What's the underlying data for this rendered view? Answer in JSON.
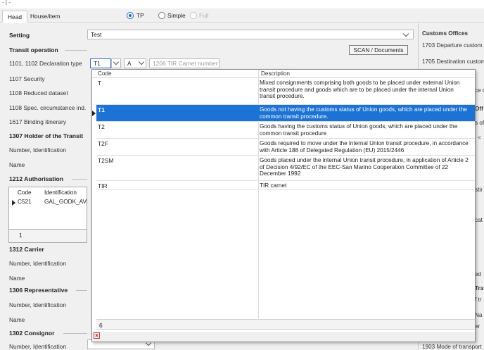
{
  "top_strip": "- | -",
  "tabs": [
    {
      "label": "Head",
      "active": true
    },
    {
      "label": "House/item",
      "active": false
    }
  ],
  "procedure_options": [
    {
      "label": "TP",
      "selected": true,
      "enabled": true
    },
    {
      "label": "Simple",
      "selected": false,
      "enabled": true
    },
    {
      "label": "Full",
      "selected": false,
      "enabled": false
    }
  ],
  "left": {
    "setting_label": "Setting",
    "transit_operation": "Transit operation",
    "declaration_type_label": "1101, 1102 Declaration type",
    "security_label": "1107 Security",
    "reduced_dataset_label": "1108 Reduced dataset",
    "spec_circumstance_label": "1108 Spec. circumstance ind.",
    "binding_itinerary_label": "1617 Binding itinerary",
    "holder_section": "1307 Holder of the Transit",
    "number_identification": "Number, Identification",
    "name_label": "Name",
    "authorisation_section": "1212 Authorisation",
    "auth_columns": [
      "Code",
      "Identification"
    ],
    "auth_rows": [
      {
        "code": "C521",
        "identification": "GAL_GODK_AVS"
      }
    ],
    "auth_count": "1",
    "carrier_section": "1312 Carrier",
    "carrier_number": "Number, Identification",
    "carrier_name": "Name",
    "representative_section": "1306 Representative",
    "representative_number": "Number, Identification",
    "representative_name": "Name",
    "consignor_section": "1302 Consignor",
    "consignor_number": "Number, Identification"
  },
  "middle": {
    "setting_value": "Test",
    "scan_button": "SCAN / Documents",
    "declaration_type_value": "T1",
    "second_select_value": "A",
    "tir_placeholder": "1206 TIR Carnet number"
  },
  "right": {
    "customs_offices": "Customs Offices",
    "departure": "1703 Departure custom",
    "destination": "1705 Destination custom",
    "frag_ce": "ce c",
    "frag_off": "Off",
    "frag_sof": "s of",
    "frag_lt": "<",
    "frag_stir": "stir",
    "frag_cat": "cat",
    "frag_ed": "ed",
    "frag_tra": "Tra",
    "frag_ftr": "f tr",
    "frag_na": "Na",
    "frag_er": "er",
    "frag_bottom": "1903 Mode of transport"
  },
  "dropdown": {
    "columns": [
      "Code",
      "Description"
    ],
    "rows": [
      {
        "code": "T",
        "description": "Mixed consignments comprising both goods to be placed under external Union transit procedure and goods which are to be placed under the internal Union transit procedure.",
        "selected": false
      },
      {
        "code": "T1",
        "description": "Goods not having the customs status of Union goods, which are placed under the common transit procedure.",
        "selected": true
      },
      {
        "code": "T2",
        "description": "Goods having the customs status of Union goods, which are placed under the common transit procedure",
        "selected": false
      },
      {
        "code": "T2F",
        "description": "Goods required to move under the internal Union transit procedure, in accordance with Article 188 of Delegated Regulation (EU) 2015/2446",
        "selected": false
      },
      {
        "code": "T2SM",
        "description": "Goods placed under the internal Union transit procedure, in application of Article 2 of Decision 4/92/EC of the EEC-San Marino Cooperation Committee of 22 December 1992",
        "selected": false
      },
      {
        "code": "TIR",
        "description": "TIR carnet",
        "selected": false
      }
    ],
    "row_count": "6"
  },
  "colors": {
    "selection": "#1c73d5",
    "radio_accent": "#1a64c9",
    "panel_bg": "#f0f0f0"
  }
}
